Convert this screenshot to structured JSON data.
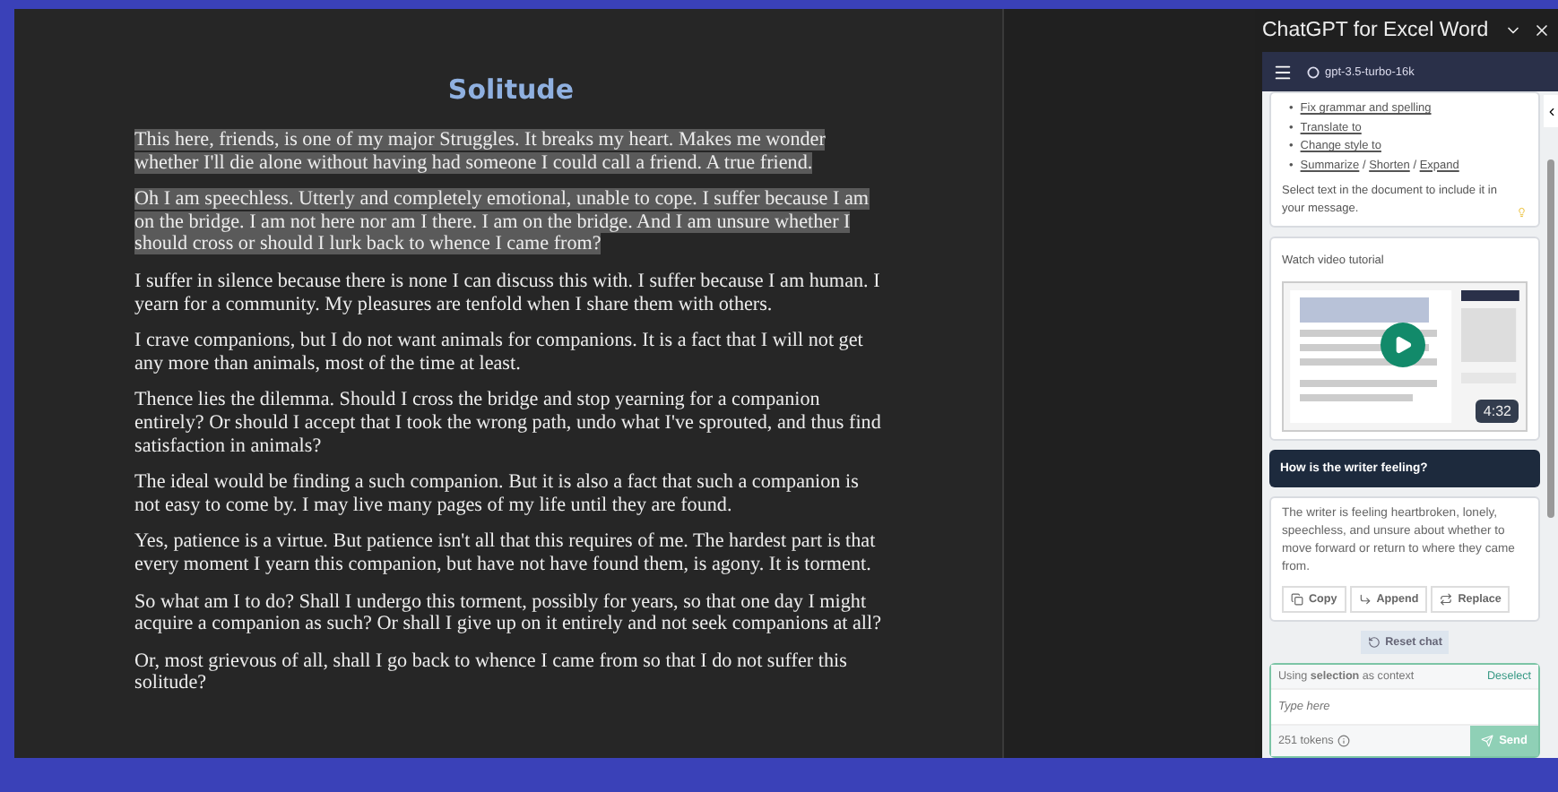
{
  "document": {
    "title": "Solitude",
    "paragraphs": [
      {
        "text": "This here, friends, is one of my major Struggles. It breaks my heart. Makes me wonder whether I'll die alone without having had someone I could call a friend. A true friend.",
        "selected": true
      },
      {
        "text": "Oh I am speechless. Utterly and completely emotional, unable to cope. I suffer because I am on the bridge. I am not here nor am I there. I am on the bridge. And I am unsure whether I should cross or should I lurk back to whence I came from?",
        "selected": true
      },
      {
        "text": "I suffer in silence because there is none I can discuss this with. I suffer because I am human. I yearn for a community. My pleasures are tenfold when I share them with others.",
        "selected": false
      },
      {
        "text": "I crave companions, but I do not want animals for companions. It is a fact that I will not get any more than animals, most of the time at least.",
        "selected": false
      },
      {
        "text": "Thence lies the dilemma. Should I cross the bridge and stop yearning for a companion entirely? Or should I accept that I took the wrong path, undo what I've sprouted, and thus find satisfaction in animals?",
        "selected": false
      },
      {
        "text": "The ideal would be finding a such companion. But it is also a fact that such a companion is not easy to come by. I may live many pages of my life until they are found.",
        "selected": false
      },
      {
        "text": "Yes, patience is a virtue. But patience isn't all that this requires of me. The hardest part is that every moment I yearn this companion, but have not have found them, is agony. It is torment.",
        "selected": false
      },
      {
        "text": "So what am I to do? Shall I undergo this torment, possibly for years, so that one day I might acquire a companion as such? Or shall I give up on it entirely and not seek companions at all?",
        "selected": false
      },
      {
        "text": "Or, most grievous of all, shall I go back to whence I came from so that I do not suffer this solitude?",
        "selected": false
      }
    ]
  },
  "panel": {
    "title": "ChatGPT for Excel Word",
    "model": "gpt-3.5-turbo-16k",
    "links": [
      [
        "Fix grammar and spelling"
      ],
      [
        "Translate to"
      ],
      [
        "Change style to"
      ],
      [
        "Summarize",
        "Shorten",
        "Expand"
      ]
    ],
    "link_separator": "/",
    "bullet": "•",
    "hint": "Select text in the document to include it in your message.",
    "video": {
      "label": "Watch video tutorial",
      "duration": "4:32"
    },
    "question": "How is the writer feeling?",
    "answer": "The writer is feeling heartbroken, lonely, speechless, and unsure about whether to move forward or return to where they came from.",
    "actions": [
      {
        "label": "Copy",
        "kind": "copy"
      },
      {
        "label": "Append",
        "kind": "append"
      },
      {
        "label": "Replace",
        "kind": "replace"
      }
    ],
    "reset": "Reset chat",
    "composer": {
      "context": "Using **selection** as context",
      "deselect": "Deselect",
      "placeholder": "Type here",
      "tokens": "251 tokens",
      "send": "Send"
    }
  }
}
